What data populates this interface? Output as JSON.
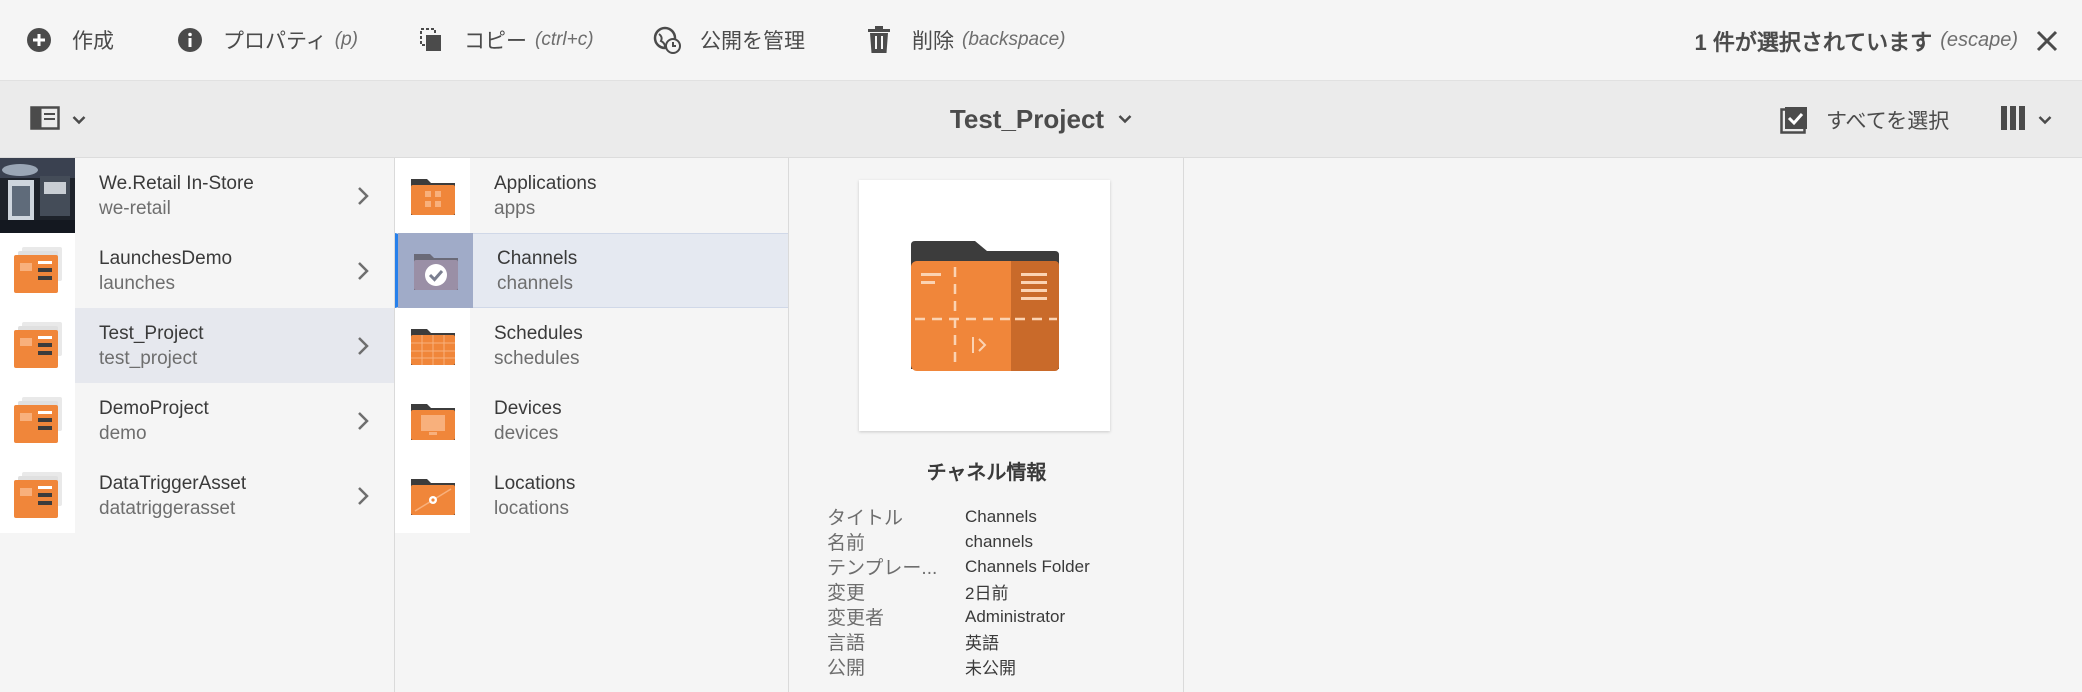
{
  "actionbar": {
    "create_label": "作成",
    "properties_label": "プロパティ",
    "properties_shortcut": "(p)",
    "copy_label": "コピー",
    "copy_shortcut": "(ctrl+c)",
    "publish_label": "公開を管理",
    "delete_label": "削除",
    "delete_shortcut": "(backspace)",
    "selection_text": "1 件が選択されています",
    "selection_shortcut": "(escape)"
  },
  "titlebar": {
    "title": "Test_Project",
    "select_all_label": "すべてを選択"
  },
  "column1": {
    "items": [
      {
        "title": "We.Retail In-Store",
        "name": "we-retail"
      },
      {
        "title": "LaunchesDemo",
        "name": "launches"
      },
      {
        "title": "Test_Project",
        "name": "test_project"
      },
      {
        "title": "DemoProject",
        "name": "demo"
      },
      {
        "title": "DataTriggerAsset",
        "name": "datatriggerasset"
      }
    ]
  },
  "column2": {
    "items": [
      {
        "title": "Applications",
        "name": "apps"
      },
      {
        "title": "Channels",
        "name": "channels"
      },
      {
        "title": "Schedules",
        "name": "schedules"
      },
      {
        "title": "Devices",
        "name": "devices"
      },
      {
        "title": "Locations",
        "name": "locations"
      }
    ]
  },
  "preview": {
    "heading": "チャネル情報",
    "meta": [
      {
        "label": "タイトル",
        "value": "Channels"
      },
      {
        "label": "名前",
        "value": "channels"
      },
      {
        "label": "テンプレー...",
        "value": "Channels Folder"
      },
      {
        "label": "変更",
        "value": "2日前"
      },
      {
        "label": "変更者",
        "value": "Administrator"
      },
      {
        "label": "言語",
        "value": "英語"
      },
      {
        "label": "公開",
        "value": "未公開"
      }
    ]
  },
  "colors": {
    "accent_orange": "#f0863a",
    "folder_dark": "#3c3c3c",
    "selection_blue": "#2680eb"
  }
}
